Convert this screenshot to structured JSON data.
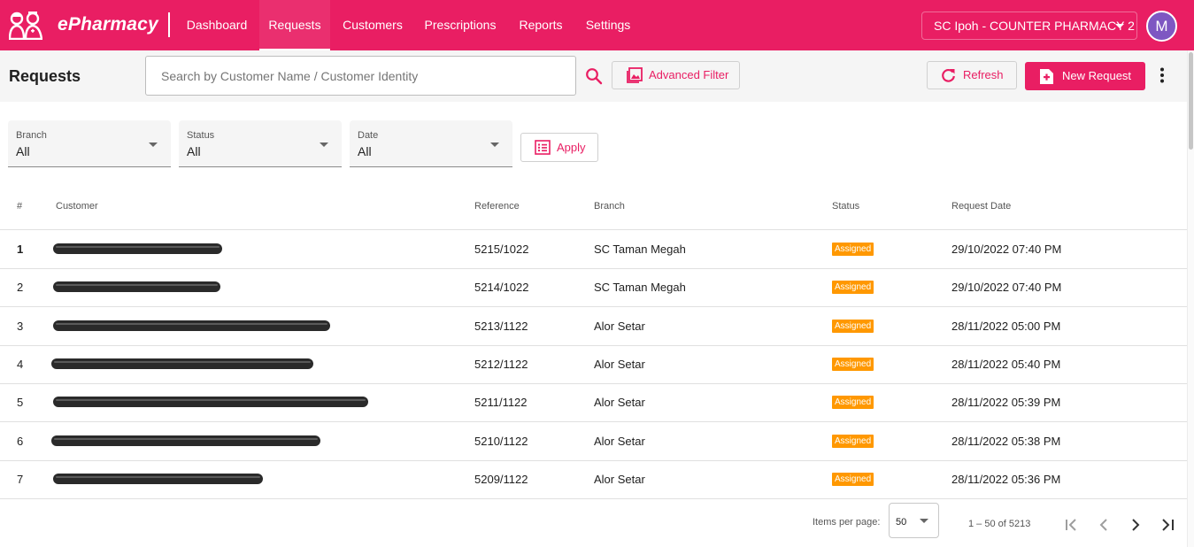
{
  "app": {
    "brand": "ePharmacy"
  },
  "nav": {
    "items": [
      {
        "label": "Dashboard"
      },
      {
        "label": "Requests"
      },
      {
        "label": "Customers"
      },
      {
        "label": "Prescriptions"
      },
      {
        "label": "Reports"
      },
      {
        "label": "Settings"
      }
    ],
    "active": "Requests"
  },
  "header": {
    "branch_selector": "SC Ipoh - COUNTER PHARMACY 2",
    "avatar_initial": "M"
  },
  "toolbar": {
    "title": "Requests",
    "search_placeholder": "Search by Customer Name / Customer Identity",
    "advanced_filter_label": "Advanced Filter",
    "refresh_label": "Refresh",
    "new_request_label": "New Request"
  },
  "filters": {
    "branch": {
      "label": "Branch",
      "value": "All"
    },
    "status": {
      "label": "Status",
      "value": "All"
    },
    "date": {
      "label": "Date",
      "value": "All"
    },
    "apply_label": "Apply"
  },
  "table": {
    "columns": [
      "#",
      "Customer",
      "Reference",
      "Branch",
      "Status",
      "Request Date"
    ],
    "rows": [
      {
        "num": "1",
        "customer": "",
        "reference": "5215/1022",
        "branch": "SC Taman Megah",
        "status": "Assigned",
        "date": "29/10/2022 07:40 PM"
      },
      {
        "num": "2",
        "customer": "",
        "reference": "5214/1022",
        "branch": "SC Taman Megah",
        "status": "Assigned",
        "date": "29/10/2022 07:40 PM"
      },
      {
        "num": "3",
        "customer": "",
        "reference": "5213/1122",
        "branch": "Alor Setar",
        "status": "Assigned",
        "date": "28/11/2022 05:00 PM"
      },
      {
        "num": "4",
        "customer": "",
        "reference": "5212/1122",
        "branch": "Alor Setar",
        "status": "Assigned",
        "date": "28/11/2022 05:40 PM"
      },
      {
        "num": "5",
        "customer": "",
        "reference": "5211/1122",
        "branch": "Alor Setar",
        "status": "Assigned",
        "date": "28/11/2022 05:39 PM"
      },
      {
        "num": "6",
        "customer": "",
        "reference": "5210/1122",
        "branch": "Alor Setar",
        "status": "Assigned",
        "date": "28/11/2022 05:38 PM"
      },
      {
        "num": "7",
        "customer": "",
        "reference": "5209/1122",
        "branch": "Alor Setar",
        "status": "Assigned",
        "date": "28/11/2022 05:36 PM"
      }
    ]
  },
  "paginator": {
    "items_per_page_label": "Items per page:",
    "page_size": "50",
    "range": "1 – 50 of 5213"
  },
  "colors": {
    "brand": "#e91e63",
    "status_assigned": "#ff9800",
    "avatar": "#7e57c2"
  },
  "icons": [
    "pharmacist-logo-icon",
    "search-icon",
    "image-filter-icon",
    "refresh-icon",
    "add-document-icon",
    "more-vert-icon",
    "list-icon",
    "first-page-icon",
    "prev-page-icon",
    "next-page-icon",
    "last-page-icon"
  ]
}
